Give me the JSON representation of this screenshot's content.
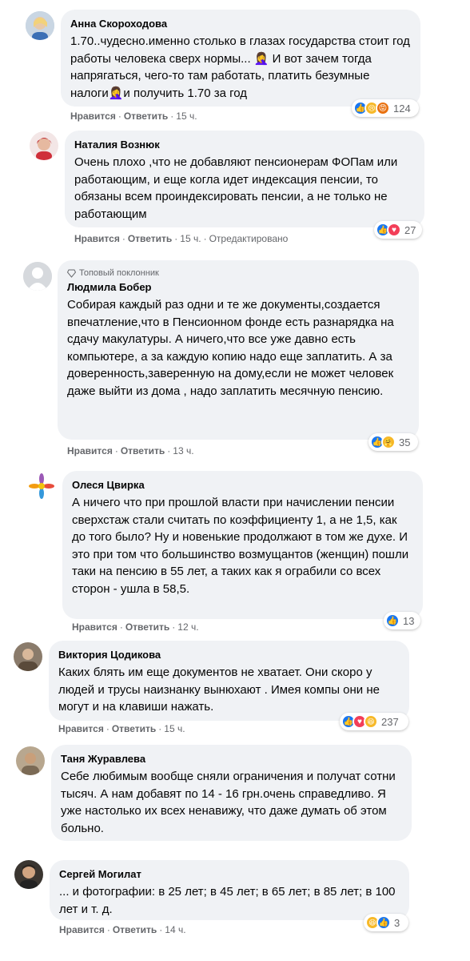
{
  "comments": [
    {
      "author": "Анна Скороходова",
      "text": "1.70..чудесно.именно столько в глазах государства стоит год работы человека сверх нормы... 🤦‍♀️ И вот зачем тогда напрягаться, чего-то там работать, платить безумные налоги🤦‍♀️и получить 1.70 за год",
      "like": "Нравится",
      "reply": "Ответить",
      "time": "15 ч.",
      "reactions": [
        "like",
        "sad",
        "angry"
      ],
      "count": "124"
    },
    {
      "author": "Наталия Вознюк",
      "text": "Очень плохо ,что не добавляют пенсионерам ФОПам или работающим, и еще когла идет индексация пенсии, то обязаны всем проиндексировать пенсии, а не только не работающим",
      "like": "Нравится",
      "reply": "Ответить",
      "time": "15 ч.",
      "edited": "Отредактировано",
      "reactions": [
        "like",
        "love"
      ],
      "count": "27"
    },
    {
      "badge": "Топовый поклонник",
      "author": "Людмила Бобер",
      "text": "Собирая каждый раз одни и те же документы,создается впечатление,что в Пенсионном фонде есть разнарядка на сдачу макулатуры. А ничего,что все уже давно есть компьютере, а за каждую копию надо еще заплатить. А за доверенность,заверенную на дому,если не может человек даже выйти из дома , надо заплатить месячную пенсию.",
      "like": "Нравится",
      "reply": "Ответить",
      "time": "13 ч.",
      "reactions": [
        "like",
        "care"
      ],
      "count": "35"
    },
    {
      "author": "Олеся Цвирка",
      "text": "А ничего что при прошлой власти при начислении пенсии сверхстаж стали считать по коэффициенту 1, а не 1,5, как до того было? Ну и новенькие продолжают в том же духе. И это при том что большинство возмущантов (женщин) пошли таки на пенсию в 55 лет, а таких как я ограбили со всех сторон - ушла в 58,5.",
      "like": "Нравится",
      "reply": "Ответить",
      "time": "12 ч.",
      "reactions": [
        "like"
      ],
      "count": "13"
    },
    {
      "author": "Виктория Цодикова",
      "text": "Каких блять им еще документов не хватает. Они скоро у людей и трусы наизнанку вынюхают . Имея компы они не могут и на клавиши нажать.",
      "like": "Нравится",
      "reply": "Ответить",
      "time": "15 ч.",
      "reactions": [
        "like",
        "love",
        "haha"
      ],
      "count": "237"
    },
    {
      "author": "Таня Журавлева",
      "text": "Себе любимым вообще сняли ограничения и получат сотни тысяч. А нам добавят по 14 - 16 грн.очень справедливо. Я уже настолько их всех ненавижу, что даже думать об этом больно.",
      "like": "",
      "reply": "",
      "time": "",
      "reactions": [],
      "count": ""
    },
    {
      "author": "Сергей Могилат",
      "text": "... и фотографии: в 25 лет; в 45 лет; в 65 лет; в 85 лет; в 100 лет и т. д.",
      "like": "Нравится",
      "reply": "Ответить",
      "time": "14 ч.",
      "reactions": [
        "haha",
        "like"
      ],
      "count": "3"
    }
  ],
  "colors": {
    "bubble": "#f0f2f5",
    "meta": "#65676b",
    "like": "#1877f2",
    "love": "#f33e58",
    "haha": "#f7b928"
  }
}
